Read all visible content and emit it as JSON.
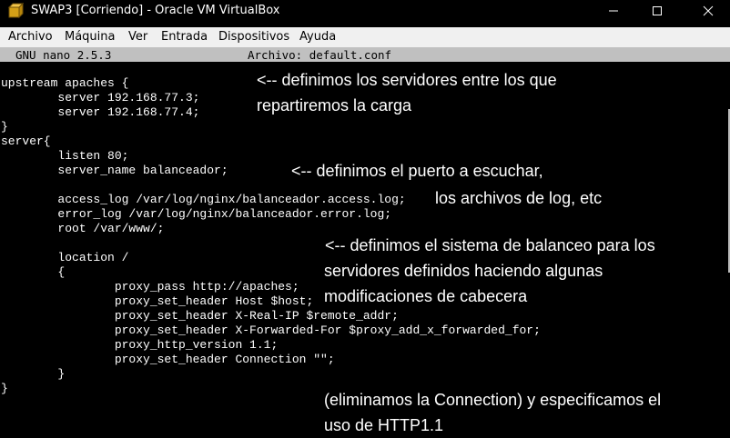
{
  "window": {
    "title": "SWAP3 [Corriendo] - Oracle VM VirtualBox",
    "minimize": "─",
    "maximize": "☐",
    "close": "✕"
  },
  "menu": [
    "Archivo",
    "Máquina",
    "Ver",
    "Entrada",
    "Dispositivos",
    "Ayuda"
  ],
  "nano": {
    "version": "GNU nano 2.5.3",
    "file": "Archivo: default.conf"
  },
  "code_lines": [
    "upstream apaches {",
    "        server 192.168.77.3;",
    "        server 192.168.77.4;",
    "}",
    "server{",
    "        listen 80;",
    "        server_name balanceador;",
    "",
    "        access_log /var/log/nginx/balanceador.access.log;",
    "        error_log /var/log/nginx/balanceador.error.log;",
    "        root /var/www/;",
    "",
    "        location /",
    "        {",
    "                proxy_pass http://apaches;",
    "                proxy_set_header Host $host;",
    "                proxy_set_header X-Real-IP $remote_addr;",
    "                proxy_set_header X-Forwarded-For $proxy_add_x_forwarded_for;",
    "                proxy_http_version 1.1;",
    "                proxy_set_header Connection \"\";",
    "        }",
    "}"
  ],
  "annotations": [
    "<-- definimos los servidores entre los que",
    "repartiremos la carga",
    "<-- definimos el puerto a escuchar,",
    "los archivos de log, etc",
    "<-- definimos el sistema de balanceo para los",
    "servidores definidos haciendo algunas",
    "modificaciones de cabecera",
    "(eliminamos la Connection) y especificamos el",
    "uso de HTTP1.1"
  ]
}
